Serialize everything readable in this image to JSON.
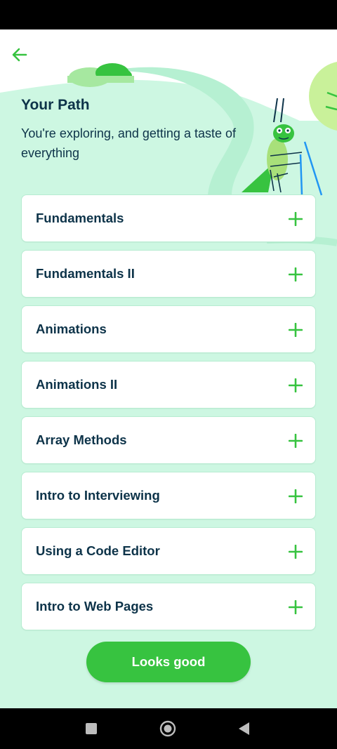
{
  "header": {
    "title": "Your Path",
    "subtitle": "You're exploring, and getting a taste of everything"
  },
  "courses": [
    {
      "label": "Fundamentals"
    },
    {
      "label": "Fundamentals II"
    },
    {
      "label": "Animations"
    },
    {
      "label": "Animations II"
    },
    {
      "label": "Array Methods"
    },
    {
      "label": "Intro to Interviewing"
    },
    {
      "label": "Using a Code Editor"
    },
    {
      "label": "Intro to Web Pages"
    }
  ],
  "actions": {
    "confirm_label": "Looks good"
  },
  "icons": {
    "back": "arrow-left-icon",
    "expand": "plus-icon",
    "illustration": "grasshopper-illustration",
    "nav_recents": "square-icon",
    "nav_home": "circle-icon",
    "nav_back": "triangle-back-icon"
  },
  "colors": {
    "accent": "#37c340",
    "background": "#cdf7e2",
    "text": "#0d3349"
  }
}
